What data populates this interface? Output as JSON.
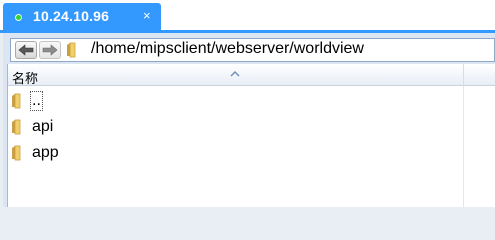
{
  "tab": {
    "title": "10.24.10.96",
    "close_glyph": "×",
    "status_color": "#32d436",
    "accent": "#3399ff"
  },
  "toolbar": {
    "back_icon": "back-arrow-icon",
    "forward_icon": "forward-arrow-icon",
    "folder_icon": "folder-icon",
    "path": "/home/mipsclient/webserver/worldview"
  },
  "list": {
    "columns": [
      {
        "label": "名称",
        "sort": "ascending"
      }
    ],
    "items": [
      {
        "name": "..",
        "icon": "folder-icon",
        "focused": true
      },
      {
        "name": "api",
        "icon": "folder-icon",
        "focused": false
      },
      {
        "name": "app",
        "icon": "folder-icon",
        "focused": false
      }
    ]
  }
}
